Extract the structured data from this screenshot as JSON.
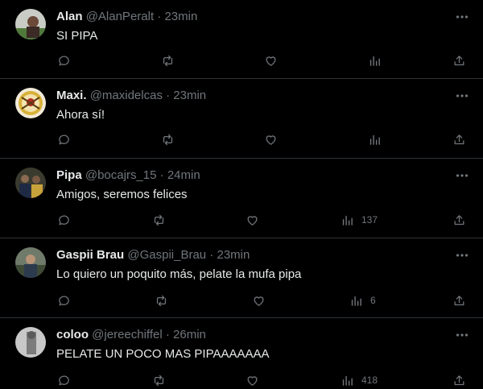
{
  "colors": {
    "background": "#000000",
    "text": "#e7e9ea",
    "secondary": "#71767b",
    "divider": "#2f3336"
  },
  "tweets": [
    {
      "name": "Alan",
      "handle": "@AlanPeralt",
      "separator": "·",
      "time": "23min",
      "text": "SI PIPA",
      "views": "",
      "avatar_icon": "photo-avatar"
    },
    {
      "name": "Maxi.",
      "handle": "@maxidelcas",
      "separator": "·",
      "time": "23min",
      "text": "Ahora sí!",
      "views": "",
      "avatar_icon": "band-logo-avatar"
    },
    {
      "name": "Pipa",
      "handle": "@bocajrs_15",
      "separator": "·",
      "time": "24min",
      "text": "Amigos, seremos felices",
      "views": "137",
      "avatar_icon": "photo-avatar"
    },
    {
      "name": "Gaspii Brau",
      "handle": "@Gaspii_Brau",
      "separator": "·",
      "time": "23min",
      "text": "Lo quiero un poquito más, pelate la mufa pipa",
      "views": "6",
      "avatar_icon": "photo-avatar"
    },
    {
      "name": "coloo",
      "handle": "@jereechiffel",
      "separator": "·",
      "time": "26min",
      "text": "PELATE UN POCO MAS PIPAAAAAAA",
      "views": "418",
      "avatar_icon": "photo-avatar"
    }
  ]
}
